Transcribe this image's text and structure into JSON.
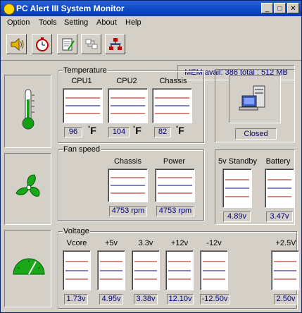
{
  "window": {
    "title": "PC Alert III System Monitor",
    "minimize": "_",
    "maximize": "□",
    "close": "✕"
  },
  "menu": [
    "Option",
    "Tools",
    "Setting",
    "About",
    "Help"
  ],
  "toolbar": {
    "icons": [
      "speaker-icon",
      "stopwatch-icon",
      "notepad-icon",
      "network-plug-icon",
      "hierarchy-icon"
    ]
  },
  "memory": {
    "text": "MEM avail: 386  total : 512 MB"
  },
  "temperature": {
    "label": "Temperature",
    "unit_symbol": "°",
    "unit": "F",
    "sensors": [
      {
        "name": "CPU1",
        "value": "96"
      },
      {
        "name": "CPU2",
        "value": "104"
      },
      {
        "name": "Chassis",
        "value": "82"
      }
    ]
  },
  "case_status": {
    "value": "Closed"
  },
  "fan_speed": {
    "label": "Fan speed",
    "fans": [
      {
        "name": "Chassis",
        "value": "4753 rpm"
      },
      {
        "name": "Power",
        "value": "4753 rpm"
      }
    ]
  },
  "standby": [
    {
      "name": "5v Standby",
      "value": "4.89v"
    },
    {
      "name": "Battery",
      "value": "3.47v"
    }
  ],
  "voltage": {
    "label": "Voltage",
    "rails": [
      {
        "name": "Vcore",
        "value": "1.73v"
      },
      {
        "name": "+5v",
        "value": "4.95v"
      },
      {
        "name": "3.3v",
        "value": "3.38v"
      },
      {
        "name": "+12v",
        "value": "12.10v"
      },
      {
        "name": "-12v",
        "value": "-12.50v"
      },
      {
        "name": "+2.5V",
        "value": "2.50v"
      }
    ]
  },
  "colors": {
    "upper_limit": "#b01000",
    "lower_limit": "#b01000",
    "reading": "#000080",
    "value_text": "#000080"
  }
}
